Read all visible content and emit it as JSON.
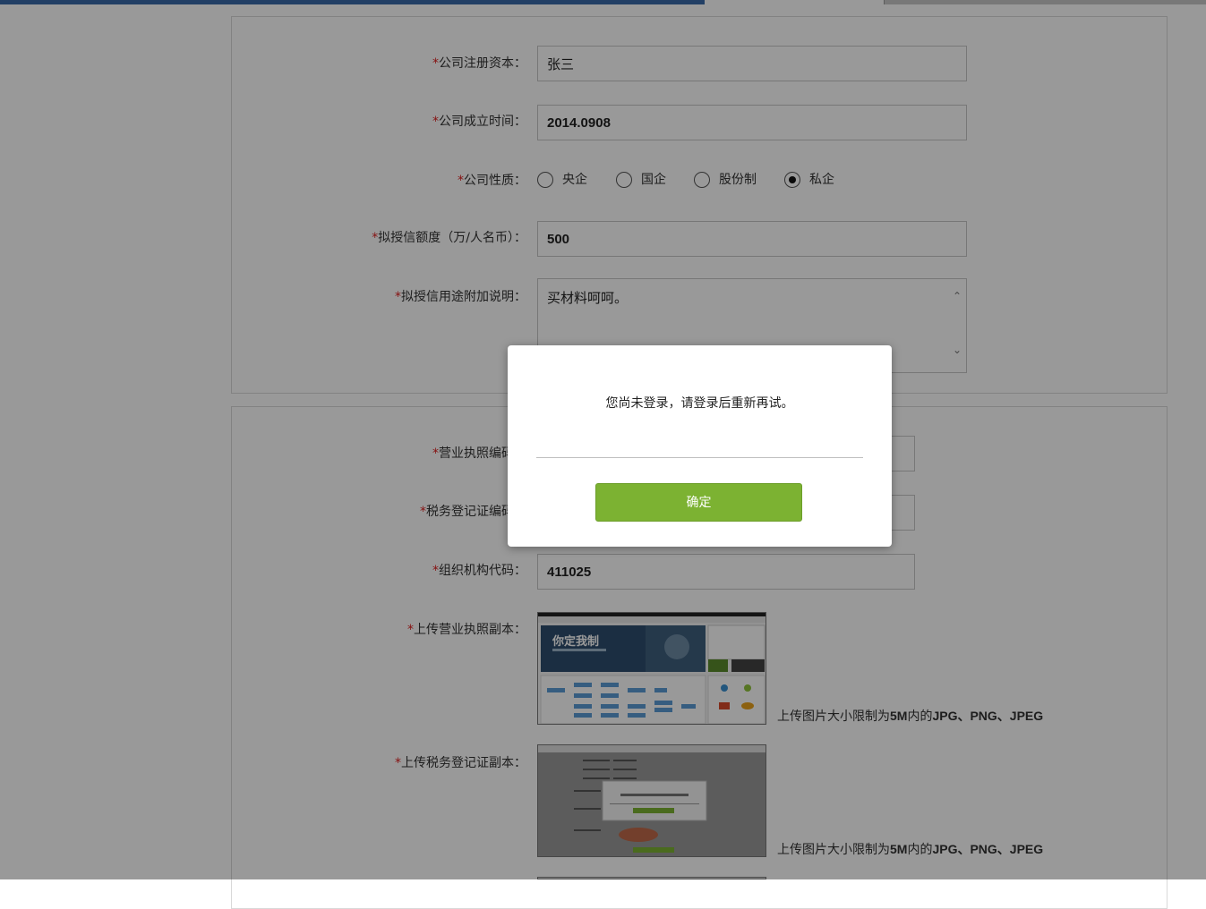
{
  "form1": {
    "registered_capital": {
      "label": "公司注册资本：",
      "value": "张三"
    },
    "established": {
      "label": "公司成立时间：",
      "value": "2014.0908"
    },
    "nature": {
      "label": "公司性质：",
      "options": [
        "央企",
        "国企",
        "股份制",
        "私企"
      ],
      "selected": "私企"
    },
    "credit_amount": {
      "label": "拟授信额度（万/人名币）：",
      "value": "500"
    },
    "credit_usage": {
      "label": "拟授信用途附加说明：",
      "value": "买材料呵呵。"
    }
  },
  "form2": {
    "business_license_no": {
      "label": "营业执照编码：",
      "value": ""
    },
    "tax_reg_no": {
      "label": "税务登记证编码：",
      "value": ""
    },
    "org_code": {
      "label": "组织机构代码：",
      "value": "411025"
    },
    "upload_license": {
      "label": "上传营业执照副本：",
      "hint_prefix": "上传图片大小限制为",
      "hint_size": "5M",
      "hint_mid": "内的",
      "hint_formats": "JPG、PNG、JPEG"
    },
    "upload_tax": {
      "label": "上传税务登记证副本：",
      "hint_prefix": "上传图片大小限制为",
      "hint_size": "5M",
      "hint_mid": "内的",
      "hint_formats": "JPG、PNG、JPEG"
    }
  },
  "thumb1_text": {
    "slogan": "你定我制"
  },
  "modal": {
    "message": "您尚未登录，请登录后重新再试。",
    "confirm_label": "确定"
  },
  "colors": {
    "required_star": "#e02020",
    "confirm_button": "#7cb232",
    "overlay": "rgba(0,0,0,0.4)"
  },
  "icons": [
    "radio-icon",
    "scroll-up-icon",
    "scroll-down-icon"
  ]
}
